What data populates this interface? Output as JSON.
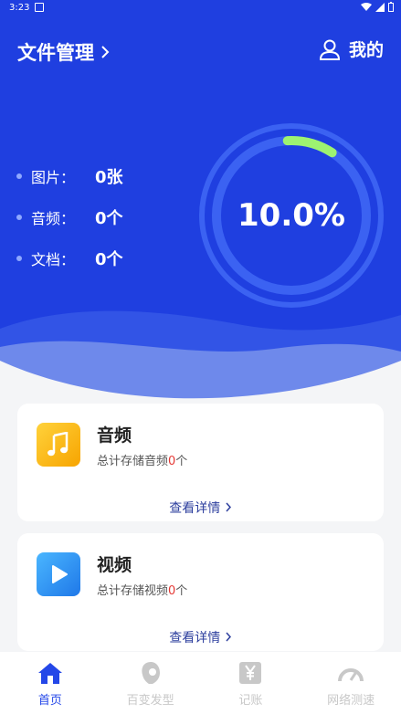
{
  "status": {
    "time": "3:23"
  },
  "header": {
    "title": "文件管理",
    "mine_label": "我的"
  },
  "stats": [
    {
      "label": "图片：",
      "value": "0张"
    },
    {
      "label": "音频：",
      "value": "0个"
    },
    {
      "label": "文档：",
      "value": "0个"
    }
  ],
  "progress": {
    "text": "10.0%",
    "value": 0.1
  },
  "cards": [
    {
      "title": "音频",
      "desc_prefix": "总计存储音频",
      "count": "0",
      "desc_suffix": "个",
      "link": "查看详情",
      "icon": "music-note-icon"
    },
    {
      "title": "视频",
      "desc_prefix": "总计存储视频",
      "count": "0",
      "desc_suffix": "个",
      "link": "查看详情",
      "icon": "play-icon"
    }
  ],
  "tabs": [
    {
      "label": "首页",
      "icon": "home-icon",
      "active": true
    },
    {
      "label": "百变发型",
      "icon": "hair-icon",
      "active": false
    },
    {
      "label": "记账",
      "icon": "yen-icon",
      "active": false
    },
    {
      "label": "网络测速",
      "icon": "speedometer-icon",
      "active": false
    }
  ],
  "colors": {
    "primary": "#1f3fe0",
    "accent": "#9df271",
    "active_tab": "#2447e8"
  }
}
